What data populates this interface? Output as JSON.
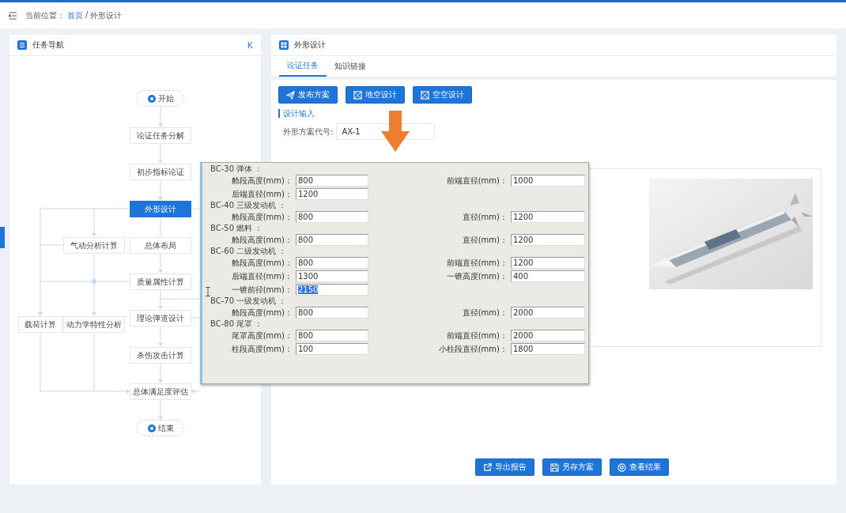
{
  "breadcrumb": {
    "label": "当前位置：",
    "items": [
      {
        "text": "首页",
        "kind": "link"
      },
      {
        "text": "/",
        "kind": "separator"
      },
      {
        "text": "外形设计",
        "kind": "current"
      }
    ]
  },
  "task_nav": {
    "title": "任务导航",
    "collapse": "K",
    "nodes": [
      {
        "text": "开始",
        "kind": "terminal",
        "selected": false
      },
      {
        "text": "论证任务分解",
        "kind": "step",
        "selected": false
      },
      {
        "text": "初步指标论证",
        "kind": "step",
        "selected": false
      },
      {
        "text": "外形设计",
        "kind": "step",
        "selected": true
      },
      {
        "text": "总体布局",
        "kind": "step",
        "selected": false
      },
      {
        "text": "质量属性计算",
        "kind": "step",
        "selected": false
      },
      {
        "text": "理论弹道设计",
        "kind": "step",
        "selected": false
      },
      {
        "text": "杀伤攻击计算",
        "kind": "step",
        "selected": false
      },
      {
        "text": "总体满足度评估",
        "kind": "step",
        "selected": false
      },
      {
        "text": "结束",
        "kind": "terminal",
        "selected": false
      },
      {
        "text": "气动分析计算",
        "kind": "step",
        "selected": false
      },
      {
        "text": "载荷计算",
        "kind": "step",
        "selected": false
      },
      {
        "text": "动力学特性分析",
        "kind": "step",
        "selected": false
      }
    ]
  },
  "main": {
    "title": "外形设计",
    "tabs": [
      {
        "label": "论证任务",
        "selected": true
      },
      {
        "label": "知识链接",
        "selected": false
      }
    ],
    "actions": [
      {
        "label": "发布方案"
      },
      {
        "label": "地空设计"
      },
      {
        "label": "空空设计"
      }
    ],
    "section": "设计输入",
    "field": {
      "label": "外形方案代号:",
      "value": "AX-1"
    },
    "footer_buttons": [
      {
        "label": "导出报告"
      },
      {
        "label": "另存方案"
      },
      {
        "label": "查看结果"
      }
    ]
  },
  "dialog": {
    "sections": [
      {
        "title": "BC-30 弹体 ：",
        "rows": [
          [
            {
              "label": "舱段高度(mm)：",
              "value": "800",
              "selected": false
            },
            {
              "label": "前端直径(mm)：",
              "value": "1000",
              "selected": false
            }
          ],
          [
            {
              "label": "后端直径(mm)：",
              "value": "1200",
              "selected": false
            }
          ]
        ]
      },
      {
        "title": "BC-40 三级发动机 ：",
        "rows": [
          [
            {
              "label": "舱段高度(mm)：",
              "value": "800",
              "selected": false
            },
            {
              "label": "直径(mm)：",
              "value": "1200",
              "selected": false
            }
          ]
        ]
      },
      {
        "title": "BC-50 燃料 ：",
        "rows": [
          [
            {
              "label": "舱段高度(mm)：",
              "value": "800",
              "selected": false
            },
            {
              "label": "直径(mm)：",
              "value": "1200",
              "selected": false
            }
          ]
        ]
      },
      {
        "title": "BC-60 二级发动机 ：",
        "rows": [
          [
            {
              "label": "舱段高度(mm)：",
              "value": "800",
              "selected": false
            },
            {
              "label": "前端直径(mm)：",
              "value": "1200",
              "selected": false
            }
          ],
          [
            {
              "label": "后端直径(mm)：",
              "value": "1300",
              "selected": false
            },
            {
              "label": "一锥高度(mm)：",
              "value": "400",
              "selected": false
            }
          ],
          [
            {
              "label": "一锥前径(mm)：",
              "value": "2150",
              "selected": true
            }
          ]
        ]
      },
      {
        "title": "BC-70 一级发动机 ：",
        "rows": [
          [
            {
              "label": "舱段高度(mm)：",
              "value": "800",
              "selected": false
            },
            {
              "label": "直径(mm)：",
              "value": "2000",
              "selected": false
            }
          ]
        ]
      },
      {
        "title": "BC-80 尾罩 ：",
        "rows": [
          [
            {
              "label": "尾罩高度(mm)：",
              "value": "800",
              "selected": false
            },
            {
              "label": "前端直径(mm)：",
              "value": "2000",
              "selected": false
            }
          ],
          [
            {
              "label": "柱段高度(mm)：",
              "value": "100",
              "selected": false
            },
            {
              "label": "小柱段直径(mm)：",
              "value": "1800",
              "selected": false
            }
          ]
        ]
      }
    ]
  }
}
